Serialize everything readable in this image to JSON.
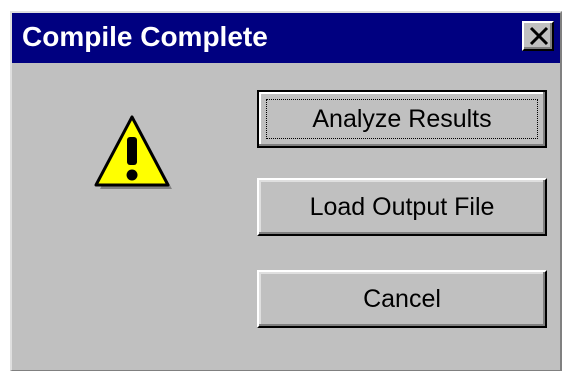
{
  "dialog": {
    "title": "Compile Complete",
    "close_glyph": "✕",
    "icon": "warning-icon",
    "buttons": [
      {
        "label": "Analyze Results",
        "default": true
      },
      {
        "label": "Load Output File",
        "default": false
      },
      {
        "label": "Cancel",
        "default": false
      }
    ]
  },
  "colors": {
    "title_bar": "#000080",
    "face": "#c0c0c0",
    "warning_fill": "#ffff00"
  }
}
